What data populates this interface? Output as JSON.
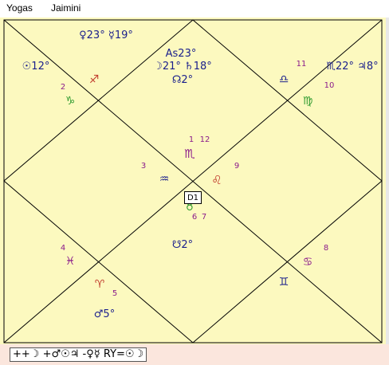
{
  "menu": {
    "items": [
      "Yogas",
      "Jaimini"
    ]
  },
  "chart": {
    "division_label": "D1",
    "colors": {
      "background": "#fcf9bf",
      "lines": "#000000",
      "planets": "#1a1f8c",
      "house_numbers": "#8b1c8b"
    },
    "signs": [
      {
        "name": "Sagittarius",
        "glyph": "♐",
        "color": "#c0392b"
      },
      {
        "name": "Capricorn",
        "glyph": "♑",
        "color": "#2e9a2e"
      },
      {
        "name": "Libra",
        "glyph": "♎",
        "color": "#1a1f8c"
      },
      {
        "name": "Virgo",
        "glyph": "♍",
        "color": "#2e9a2e"
      },
      {
        "name": "Scorpio",
        "glyph": "♏",
        "color": "#8b1c8b"
      },
      {
        "name": "Aquarius",
        "glyph": "♒",
        "color": "#1a1f8c"
      },
      {
        "name": "Leo",
        "glyph": "♌",
        "color": "#c0392b"
      },
      {
        "name": "Taurus",
        "glyph": "♉",
        "color": "#2e9a2e"
      },
      {
        "name": "Pisces",
        "glyph": "♓",
        "color": "#8b1c8b"
      },
      {
        "name": "Aries",
        "glyph": "♈",
        "color": "#c0392b"
      },
      {
        "name": "Cancer",
        "glyph": "♋",
        "color": "#8b1c8b"
      },
      {
        "name": "Gemini",
        "glyph": "♊",
        "color": "#1a1f8c"
      }
    ],
    "house_numbers": [
      "1",
      "12",
      "2",
      "11",
      "3",
      "9",
      "10",
      "6",
      "7",
      "4",
      "8",
      "5"
    ],
    "planet_lines": [
      "♀23° ☿19°",
      "☉12°",
      "As23°",
      "☽21° ♄18°",
      "☊2°",
      "♏22° ♃8°",
      "☋2°",
      "♂5°"
    ]
  },
  "status": {
    "yoga_line": "++☽ +♂☉♃ -♀☿  RY=☉☽"
  }
}
